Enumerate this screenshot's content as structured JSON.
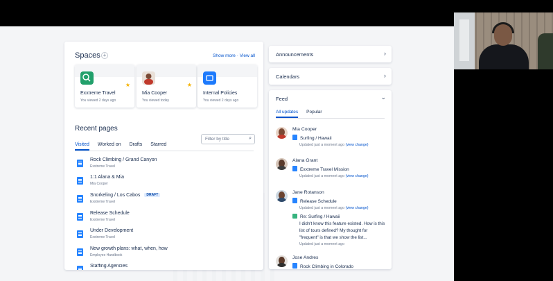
{
  "spaces": {
    "title": "Spaces",
    "add": "+",
    "show_more": "Show more",
    "separator": "·",
    "view_all": "View all",
    "items": [
      {
        "name": "Exxtreme Travel",
        "sub": "You viewed 2 days ago",
        "color": "#22a06b"
      },
      {
        "name": "Mia Cooper",
        "sub": "You viewed today",
        "color": "#e9e0d8"
      },
      {
        "name": "Internal Policies",
        "sub": "You viewed 2 days ago",
        "color": "#1d7afc"
      }
    ]
  },
  "recent": {
    "title": "Recent pages",
    "tabs": [
      "Visited",
      "Worked on",
      "Drafts",
      "Starred"
    ],
    "filter_placeholder": "Filter by title",
    "pages": [
      {
        "title": "Rock Climbing / Grand Canyon",
        "space": "Exxtreme Travel"
      },
      {
        "title": "1:1 Alana & Mia",
        "space": "Mia Cooper"
      },
      {
        "title": "Snorkeling / Los Cabos",
        "space": "Exxtreme Travel",
        "badge": "DRAFT"
      },
      {
        "title": "Release Schedule",
        "space": "Exxtreme Travel"
      },
      {
        "title": "Under Development",
        "space": "Exxtreme Travel"
      },
      {
        "title": "New growth plans: what, when, how",
        "space": "Employee Handbook"
      },
      {
        "title": "Staffing Agencies",
        "space": ""
      }
    ]
  },
  "right": {
    "announcements": "Announcements",
    "calendars": "Calendars",
    "feed": {
      "title": "Feed",
      "tabs": [
        "All updates",
        "Popular"
      ],
      "updated": "Updated just a moment ago",
      "view_change": "(view change)",
      "items": [
        {
          "name": "Mia Cooper",
          "doc": "Surfing / Hawaii"
        },
        {
          "name": "Alana Grant",
          "doc": "Exxtreme Travel Mission"
        },
        {
          "name": "Jane Rotanson",
          "doc": "Release Schedule",
          "comment_title": "Re: Surfing / Hawaii",
          "comment": "I didn't know this feature existed. How is this list of tours defined? My thought for \"frequent\" is that we show the list..."
        },
        {
          "name": "Jose Andres",
          "doc": "Rock Climbing in Colorado"
        }
      ]
    }
  },
  "colors": {
    "accent": "#0052cc",
    "star": "#f5b200",
    "doc": "#2684ff"
  }
}
